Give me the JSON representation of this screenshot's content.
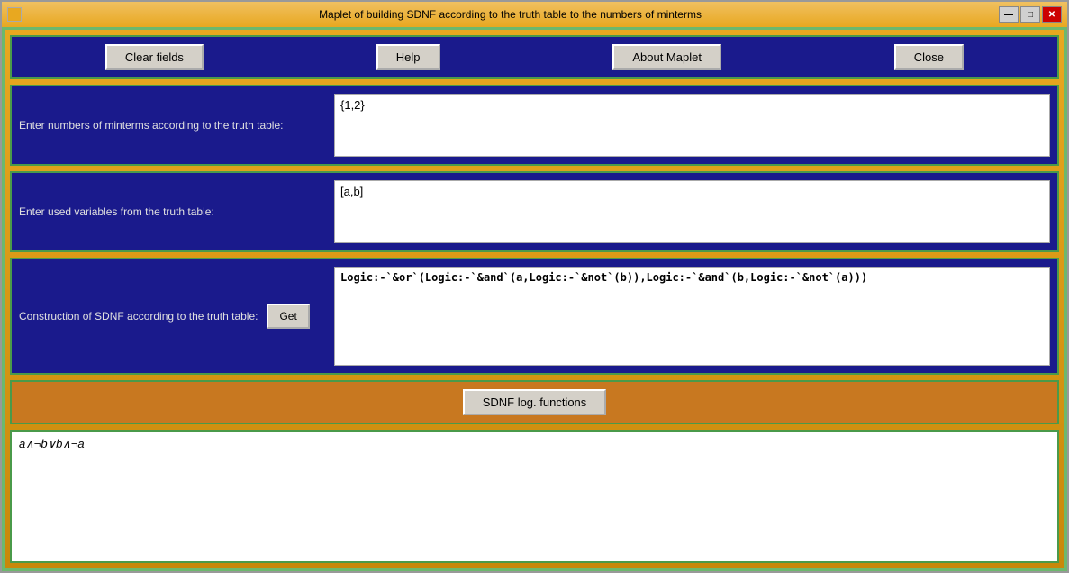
{
  "window": {
    "title": "Maplet of building SDNF according to the truth table to the numbers of minterms",
    "icon": "maple-icon"
  },
  "title_controls": {
    "minimize_label": "—",
    "maximize_label": "□",
    "close_label": "✕"
  },
  "toolbar": {
    "clear_fields_label": "Clear fields",
    "help_label": "Help",
    "about_label": "About Maplet",
    "close_label": "Close"
  },
  "minterms_section": {
    "label": "Enter numbers of minterms according to the truth table:",
    "value": "{1,2}"
  },
  "variables_section": {
    "label": "Enter used variables from the truth table:",
    "value": "[a,b]"
  },
  "sdnf_section": {
    "label": "Construction of SDNF according to the truth table:",
    "get_label": "Get",
    "result": "Logic:-`&or`(Logic:-`&and`(a,Logic:-`&not`(b)),Logic:-`&and`(b,Logic:-`&not`(a)))"
  },
  "sdnf_bar": {
    "button_label": "SDNF log. functions"
  },
  "output": {
    "value": "a∧¬b∨b∧¬a"
  }
}
